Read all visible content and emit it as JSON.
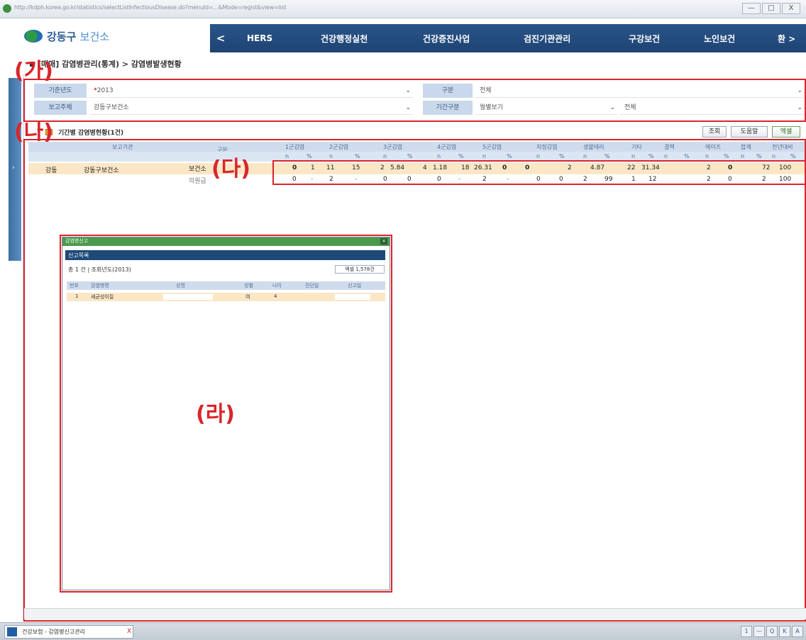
{
  "browser": {
    "url": "http://kdph.korea.go.kr/statistics/selectListInfectiousDisease.do?menuId=...&Mode=regist&view=list",
    "minimize": "—",
    "maximize": "□",
    "close": "X"
  },
  "header": {
    "logo_text": "강동구",
    "logo_text2": "보건소",
    "nav_prev": "<",
    "nav_items": [
      "HERS",
      "건강행정실천",
      "건강증진사업",
      "검진기관관리",
      "구강보건",
      "노인보건",
      "환 >"
    ]
  },
  "breadcrumb": "[매매] 감염병관리(통계) > 감염병발생현황",
  "search": {
    "label_1": "기준년도",
    "value_1": "2013",
    "label_2": "구분",
    "value_2": "전체",
    "label_3": "보고주체",
    "value_3": "강동구보건소",
    "label_4": "기간구분",
    "value_4": "월별보기",
    "value_5": "전체"
  },
  "section": {
    "star": "*",
    "title": "기간별 감염병현황(1건)",
    "btn_search": "조회",
    "btn_print": "도움말",
    "btn_excel": "엑셀"
  },
  "table": {
    "head1": [
      "보고기관",
      "구분",
      "1군감염",
      "2군감염",
      "3군감염",
      "4군감염",
      "5군감염",
      "지정감염",
      "생물테러",
      "기타",
      "결핵",
      "에이즈",
      "합계",
      "전년대비"
    ],
    "head2": [
      "n",
      "%",
      "n",
      "%",
      "n",
      "%",
      "n",
      "%",
      "n",
      "%",
      "n",
      "%",
      "n",
      "%",
      "n",
      "%",
      "n",
      "%",
      "n",
      "%",
      "n",
      "%",
      "n",
      "%"
    ],
    "row1_org": "강동",
    "row1_name": "강동구보건소",
    "row1_type": "보건소",
    "row1_values": [
      "0",
      "1",
      "11",
      "15",
      "2",
      "5.84",
      "4",
      "1.18",
      "18",
      "26.31",
      "0",
      "0",
      "2",
      "4.87",
      "22",
      "31.34",
      "2",
      "0",
      "72",
      "100"
    ],
    "row2_type": "의원급",
    "row2_values": [
      "0",
      "-",
      "2",
      "-",
      "0",
      "0",
      "0",
      "-",
      "2",
      "-",
      "0",
      "0",
      "2",
      "99",
      "1",
      "12",
      "2",
      "0",
      "2",
      "100"
    ]
  },
  "popup": {
    "title": "감염병신고",
    "subtitle": "신고목록",
    "info": "총 1 건 | 조회년도(2013)",
    "btn": "엑셀 1,578건",
    "headers": [
      "번호",
      "감염병명",
      "성명",
      "성별",
      "나이",
      "진단일",
      "신고일"
    ],
    "row": [
      "1",
      "세균성이질",
      "",
      "여",
      "4",
      "",
      ""
    ]
  },
  "annotations": [
    "(가)",
    "(나)",
    "(다)",
    "(라)"
  ],
  "taskbar": {
    "tab_label": "건강보험 - 감염병신고관리",
    "tab_close": "X",
    "tray": [
      "1",
      "—",
      "Q",
      "K",
      "A"
    ]
  },
  "colors": {
    "nav_bg": "#1e4373",
    "annotation_red": "#d9252b",
    "row_highlight": "#fbe7c6",
    "header_blue": "#cfdcee",
    "popup_green": "#4a9a4e"
  }
}
